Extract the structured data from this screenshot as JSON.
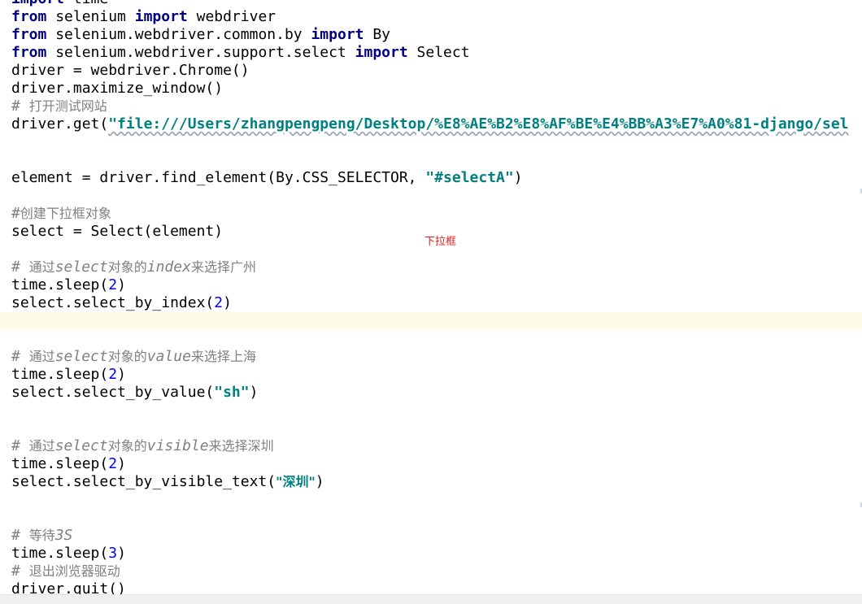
{
  "editor": {
    "lines": [
      {
        "segments": [
          {
            "text": "import",
            "style": "kw"
          },
          {
            "text": " time",
            "style": "plain"
          }
        ]
      },
      {
        "segments": [
          {
            "text": "from",
            "style": "kw"
          },
          {
            "text": " selenium ",
            "style": "plain"
          },
          {
            "text": "import",
            "style": "kw"
          },
          {
            "text": " webdriver",
            "style": "plain"
          }
        ]
      },
      {
        "segments": [
          {
            "text": "from",
            "style": "kw"
          },
          {
            "text": " selenium.webdriver.common.by ",
            "style": "plain"
          },
          {
            "text": "import",
            "style": "kw"
          },
          {
            "text": " By",
            "style": "plain"
          }
        ]
      },
      {
        "segments": [
          {
            "text": "from",
            "style": "kw"
          },
          {
            "text": " selenium.webdriver.support.select ",
            "style": "plain"
          },
          {
            "text": "import",
            "style": "kw"
          },
          {
            "text": " Select",
            "style": "plain"
          }
        ]
      },
      {
        "segments": [
          {
            "text": "driver = webdriver.Chrome()",
            "style": "plain"
          }
        ]
      },
      {
        "segments": [
          {
            "text": "driver.maximize_window()",
            "style": "plain"
          }
        ]
      },
      {
        "segments": [
          {
            "text": "# ",
            "style": "cmt"
          },
          {
            "text": "打开测试网站",
            "style": "cmt cjk"
          }
        ]
      },
      {
        "segments": [
          {
            "text": "driver.get(",
            "style": "plain"
          },
          {
            "text": "\"file:///Users/zhangpengpeng/Desktop/%E8%AE%B2%E8%AF%BE%E4%BB%A3%E7%A0%81-django/sel",
            "style": "str squiggle"
          }
        ]
      },
      {
        "segments": []
      },
      {
        "segments": []
      },
      {
        "segments": [
          {
            "text": "element = driver.find_element(By.CSS_SELECTOR, ",
            "style": "plain"
          },
          {
            "text": "\"#selectA\"",
            "style": "str"
          },
          {
            "text": ")",
            "style": "plain"
          }
        ]
      },
      {
        "segments": []
      },
      {
        "segments": [
          {
            "text": "#",
            "style": "cmt"
          },
          {
            "text": "创建下拉框对象",
            "style": "cmt cjk"
          }
        ]
      },
      {
        "segments": [
          {
            "text": "select = Select(element)",
            "style": "plain"
          }
        ]
      },
      {
        "segments": []
      },
      {
        "segments": [
          {
            "text": "# ",
            "style": "cmt"
          },
          {
            "text": "通过",
            "style": "cmt cjk"
          },
          {
            "text": "select",
            "style": "cmt-it"
          },
          {
            "text": "对象的",
            "style": "cmt cjk"
          },
          {
            "text": "index",
            "style": "cmt-it"
          },
          {
            "text": "来选择广州",
            "style": "cmt cjk"
          }
        ]
      },
      {
        "segments": [
          {
            "text": "time.sleep(",
            "style": "plain"
          },
          {
            "text": "2",
            "style": "num"
          },
          {
            "text": ")",
            "style": "plain"
          }
        ]
      },
      {
        "segments": [
          {
            "text": "select.select_by_index(",
            "style": "plain"
          },
          {
            "text": "2",
            "style": "num"
          },
          {
            "text": ")",
            "style": "plain"
          }
        ]
      },
      {
        "segments": [],
        "current": true
      },
      {
        "segments": []
      },
      {
        "segments": [
          {
            "text": "# ",
            "style": "cmt"
          },
          {
            "text": "通过",
            "style": "cmt cjk"
          },
          {
            "text": "select",
            "style": "cmt-it"
          },
          {
            "text": "对象的",
            "style": "cmt cjk"
          },
          {
            "text": "value",
            "style": "cmt-it"
          },
          {
            "text": "来选择上海",
            "style": "cmt cjk"
          }
        ]
      },
      {
        "segments": [
          {
            "text": "time.sleep(",
            "style": "plain"
          },
          {
            "text": "2",
            "style": "num"
          },
          {
            "text": ")",
            "style": "plain"
          }
        ]
      },
      {
        "segments": [
          {
            "text": "select.select_by_value(",
            "style": "plain"
          },
          {
            "text": "\"sh\"",
            "style": "str"
          },
          {
            "text": ")",
            "style": "plain"
          }
        ]
      },
      {
        "segments": []
      },
      {
        "segments": []
      },
      {
        "segments": [
          {
            "text": "# ",
            "style": "cmt"
          },
          {
            "text": "通过",
            "style": "cmt cjk"
          },
          {
            "text": "select",
            "style": "cmt-it"
          },
          {
            "text": "对象的",
            "style": "cmt cjk"
          },
          {
            "text": "visible",
            "style": "cmt-it"
          },
          {
            "text": "来选择深圳",
            "style": "cmt cjk"
          }
        ]
      },
      {
        "segments": [
          {
            "text": "time.sleep(",
            "style": "plain"
          },
          {
            "text": "2",
            "style": "num"
          },
          {
            "text": ")",
            "style": "plain"
          }
        ]
      },
      {
        "segments": [
          {
            "text": "select.select_by_visible_text(",
            "style": "plain"
          },
          {
            "text": "\"深圳\"",
            "style": "str cjk"
          },
          {
            "text": ")",
            "style": "plain"
          }
        ]
      },
      {
        "segments": []
      },
      {
        "segments": []
      },
      {
        "segments": [
          {
            "text": "# ",
            "style": "cmt"
          },
          {
            "text": "等待",
            "style": "cmt cjk"
          },
          {
            "text": "3S",
            "style": "cmt-it"
          }
        ]
      },
      {
        "segments": [
          {
            "text": "time.sleep(",
            "style": "plain"
          },
          {
            "text": "3",
            "style": "num"
          },
          {
            "text": ")",
            "style": "plain"
          }
        ]
      },
      {
        "segments": [
          {
            "text": "# ",
            "style": "cmt"
          },
          {
            "text": "退出浏览器驱动",
            "style": "cmt cjk"
          }
        ]
      },
      {
        "segments": [
          {
            "text": "driver.quit()",
            "style": "plain"
          }
        ]
      }
    ]
  },
  "annotation": {
    "text": "下拉框",
    "color": "#e0201e"
  }
}
